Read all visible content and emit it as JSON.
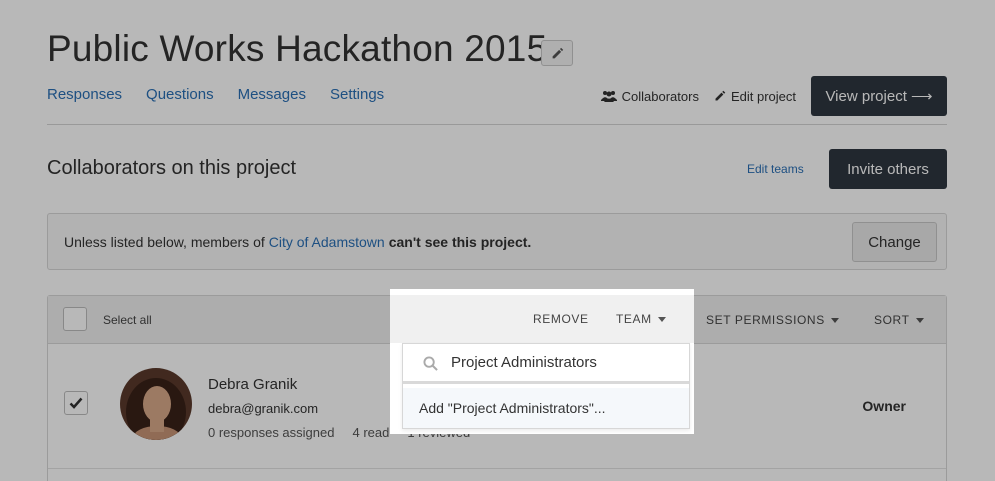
{
  "project": {
    "title": "Public Works Hackathon 2015"
  },
  "nav": {
    "tabs": [
      {
        "label": "Responses"
      },
      {
        "label": "Questions"
      },
      {
        "label": "Messages"
      },
      {
        "label": "Settings"
      }
    ]
  },
  "header_actions": {
    "collaborators_label": "Collaborators",
    "edit_project_label": "Edit project",
    "view_project_label": "View project ⟶"
  },
  "collaborators": {
    "section_title": "Collaborators on this project",
    "edit_teams_label": "Edit teams",
    "invite_label": "Invite others"
  },
  "notice": {
    "prefix": "Unless listed below, members of",
    "org_link": "City of Adamstown",
    "suffix": "can't see this project.",
    "change_label": "Change"
  },
  "list_header": {
    "select_all": "Select all",
    "remove": "REMOVE",
    "team": "TEAM",
    "set_permissions": "SET PERMISSIONS",
    "sort": "SORT"
  },
  "people": [
    {
      "name": "Debra Granik",
      "email": "debra@granik.com",
      "responses_assigned": "0 responses assigned",
      "read": "4 read",
      "reviewed": "1 reviewed",
      "role": "Owner",
      "checked": true
    }
  ],
  "team_dropdown": {
    "search_value": "Project Administrators",
    "add_option": "Add \"Project Administrators\"..."
  },
  "colors": {
    "link": "#2a6fb5",
    "dark_button": "#2e3640",
    "overlay": "rgba(0,0,0,0.28)"
  }
}
